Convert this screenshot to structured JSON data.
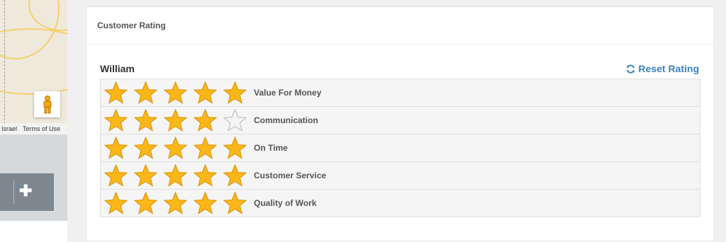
{
  "map": {
    "footer_region": "Israel",
    "footer_terms": "Terms of Use",
    "pegman_icon": "pegman-icon"
  },
  "sidebar": {
    "add_icon": "plus-icon"
  },
  "panel": {
    "title": "Customer Rating",
    "user_name": "William",
    "reset_label": "Reset Rating",
    "reset_icon": "refresh-icon",
    "star_color": "#fbb718",
    "accent": "#3a82c4",
    "max_stars": 5,
    "ratings": [
      {
        "label": "Value For Money",
        "stars": 5
      },
      {
        "label": "Communication",
        "stars": 4
      },
      {
        "label": "On Time",
        "stars": 5
      },
      {
        "label": "Customer Service",
        "stars": 5
      },
      {
        "label": "Quality of Work",
        "stars": 5
      }
    ]
  }
}
